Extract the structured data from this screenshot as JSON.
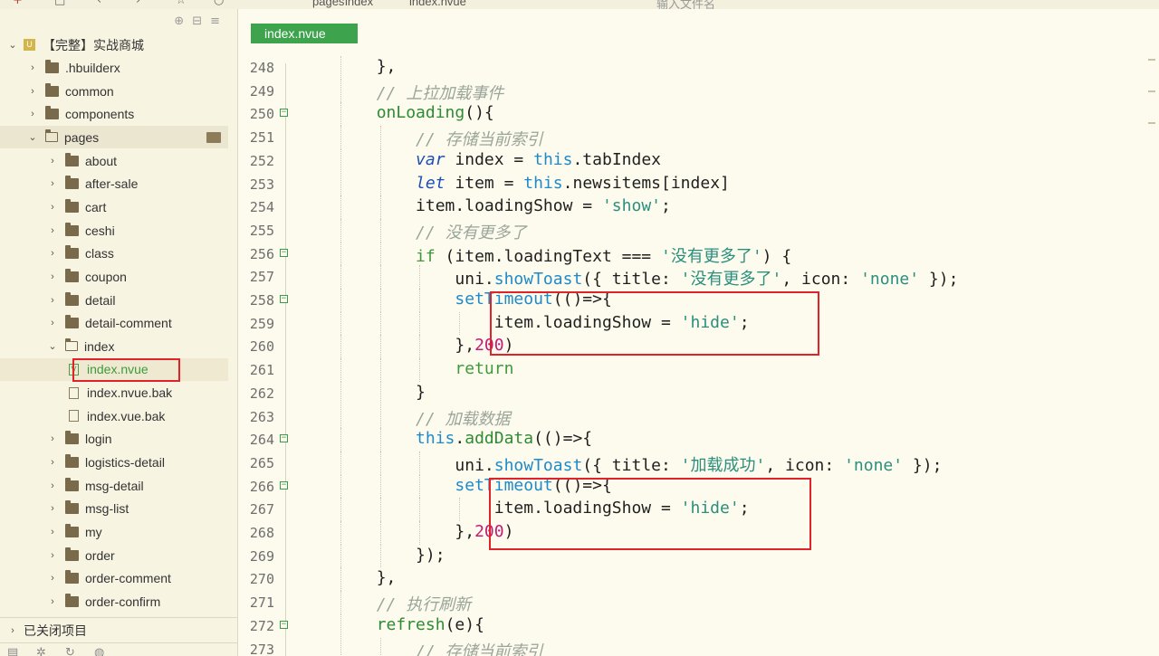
{
  "topbar": {
    "crumb_pages": "pages",
    "crumb_index": "index",
    "crumb_file": "index.nvue",
    "search_placeholder": "输入文件名"
  },
  "sidebar": {
    "project": "【完整】实战商城",
    "items": [
      {
        "label": ".hbuilderx",
        "type": "folder",
        "depth": 1
      },
      {
        "label": "common",
        "type": "folder",
        "depth": 1
      },
      {
        "label": "components",
        "type": "folder",
        "depth": 1
      },
      {
        "label": "pages",
        "type": "folder-open",
        "depth": 1
      },
      {
        "label": "about",
        "type": "folder",
        "depth": 2
      },
      {
        "label": "after-sale",
        "type": "folder",
        "depth": 2
      },
      {
        "label": "cart",
        "type": "folder",
        "depth": 2
      },
      {
        "label": "ceshi",
        "type": "folder",
        "depth": 2
      },
      {
        "label": "class",
        "type": "folder",
        "depth": 2
      },
      {
        "label": "coupon",
        "type": "folder",
        "depth": 2
      },
      {
        "label": "detail",
        "type": "folder",
        "depth": 2
      },
      {
        "label": "detail-comment",
        "type": "folder",
        "depth": 2
      },
      {
        "label": "index",
        "type": "folder-open",
        "depth": 2
      },
      {
        "label": "index.nvue",
        "type": "vue-file",
        "depth": 3
      },
      {
        "label": "index.nvue.bak",
        "type": "file",
        "depth": 3
      },
      {
        "label": "index.vue.bak",
        "type": "file",
        "depth": 3
      },
      {
        "label": "login",
        "type": "folder",
        "depth": 2
      },
      {
        "label": "logistics-detail",
        "type": "folder",
        "depth": 2
      },
      {
        "label": "msg-detail",
        "type": "folder",
        "depth": 2
      },
      {
        "label": "msg-list",
        "type": "folder",
        "depth": 2
      },
      {
        "label": "my",
        "type": "folder",
        "depth": 2
      },
      {
        "label": "order",
        "type": "folder",
        "depth": 2
      },
      {
        "label": "order-comment",
        "type": "folder",
        "depth": 2
      },
      {
        "label": "order-confirm",
        "type": "folder",
        "depth": 2
      }
    ],
    "closed_projects": "已关闭项目"
  },
  "editor": {
    "tab_label": "index.nvue",
    "lines": [
      {
        "n": "248",
        "fold": false,
        "tokens": [
          [
            "t-punc",
            "        },"
          ]
        ]
      },
      {
        "n": "249",
        "fold": false,
        "tokens": [
          [
            "t-cm",
            "        // 上拉加载事件"
          ]
        ]
      },
      {
        "n": "250",
        "fold": true,
        "tokens": [
          [
            "t-fn",
            "        onLoading"
          ],
          [
            "t-punc",
            "(){"
          ]
        ]
      },
      {
        "n": "251",
        "fold": false,
        "tokens": [
          [
            "t-cm",
            "            // 存储当前索引"
          ]
        ]
      },
      {
        "n": "252",
        "fold": false,
        "tokens": [
          [
            "t-kw",
            "            var"
          ],
          [
            "t-id",
            " index "
          ],
          [
            "t-punc",
            "= "
          ],
          [
            "t-this",
            "this"
          ],
          [
            "t-punc",
            ".tabIndex"
          ]
        ]
      },
      {
        "n": "253",
        "fold": false,
        "tokens": [
          [
            "t-kw",
            "            let"
          ],
          [
            "t-id",
            " item "
          ],
          [
            "t-punc",
            "= "
          ],
          [
            "t-this",
            "this"
          ],
          [
            "t-punc",
            ".newsitems[index]"
          ]
        ]
      },
      {
        "n": "254",
        "fold": false,
        "tokens": [
          [
            "t-id",
            "            item.loadingShow "
          ],
          [
            "t-punc",
            "= "
          ],
          [
            "t-str",
            "'show'"
          ],
          [
            "t-punc",
            ";"
          ]
        ]
      },
      {
        "n": "255",
        "fold": false,
        "tokens": [
          [
            "t-cm",
            "            // 没有更多了"
          ]
        ]
      },
      {
        "n": "256",
        "fold": true,
        "tokens": [
          [
            "t-ctrl",
            "            if"
          ],
          [
            "t-punc",
            " (item.loadingText "
          ],
          [
            "t-punc",
            "=== "
          ],
          [
            "t-str",
            "'没有更多了'"
          ],
          [
            "t-punc",
            ") {"
          ]
        ]
      },
      {
        "n": "257",
        "fold": false,
        "tokens": [
          [
            "t-id",
            "                uni."
          ],
          [
            "t-call",
            "showToast"
          ],
          [
            "t-punc",
            "({ title: "
          ],
          [
            "t-str",
            "'没有更多了'"
          ],
          [
            "t-punc",
            ", icon: "
          ],
          [
            "t-str",
            "'none'"
          ],
          [
            "t-punc",
            " });"
          ]
        ]
      },
      {
        "n": "258",
        "fold": true,
        "tokens": [
          [
            "t-call",
            "                setTimeout"
          ],
          [
            "t-punc",
            "(()=>{"
          ]
        ]
      },
      {
        "n": "259",
        "fold": false,
        "tokens": [
          [
            "t-id",
            "                    item.loadingShow "
          ],
          [
            "t-punc",
            "= "
          ],
          [
            "t-str",
            "'hide'"
          ],
          [
            "t-punc",
            ";"
          ]
        ]
      },
      {
        "n": "260",
        "fold": false,
        "tokens": [
          [
            "t-punc",
            "                },"
          ],
          [
            "t-num",
            "200"
          ],
          [
            "t-punc",
            ")"
          ]
        ]
      },
      {
        "n": "261",
        "fold": false,
        "tokens": [
          [
            "t-ctrl",
            "                return"
          ]
        ]
      },
      {
        "n": "262",
        "fold": false,
        "tokens": [
          [
            "t-punc",
            "            }"
          ]
        ]
      },
      {
        "n": "263",
        "fold": false,
        "tokens": [
          [
            "t-cm",
            "            // 加载数据"
          ]
        ]
      },
      {
        "n": "264",
        "fold": true,
        "tokens": [
          [
            "t-this",
            "            this"
          ],
          [
            "t-punc",
            "."
          ],
          [
            "t-fn",
            "addData"
          ],
          [
            "t-punc",
            "(()=>{"
          ]
        ]
      },
      {
        "n": "265",
        "fold": false,
        "tokens": [
          [
            "t-id",
            "                uni."
          ],
          [
            "t-call",
            "showToast"
          ],
          [
            "t-punc",
            "({ title: "
          ],
          [
            "t-str",
            "'加载成功'"
          ],
          [
            "t-punc",
            ", icon: "
          ],
          [
            "t-str",
            "'none'"
          ],
          [
            "t-punc",
            " });"
          ]
        ]
      },
      {
        "n": "266",
        "fold": true,
        "tokens": [
          [
            "t-call",
            "                setTimeout"
          ],
          [
            "t-punc",
            "(()=>{"
          ]
        ]
      },
      {
        "n": "267",
        "fold": false,
        "tokens": [
          [
            "t-id",
            "                    item.loadingShow "
          ],
          [
            "t-punc",
            "= "
          ],
          [
            "t-str",
            "'hide'"
          ],
          [
            "t-punc",
            ";"
          ]
        ]
      },
      {
        "n": "268",
        "fold": false,
        "tokens": [
          [
            "t-punc",
            "                },"
          ],
          [
            "t-num",
            "200"
          ],
          [
            "t-punc",
            ")"
          ]
        ]
      },
      {
        "n": "269",
        "fold": false,
        "tokens": [
          [
            "t-punc",
            "            });"
          ]
        ]
      },
      {
        "n": "270",
        "fold": false,
        "tokens": [
          [
            "t-punc",
            "        },"
          ]
        ]
      },
      {
        "n": "271",
        "fold": false,
        "tokens": [
          [
            "t-cm",
            "        // 执行刷新"
          ]
        ]
      },
      {
        "n": "272",
        "fold": true,
        "tokens": [
          [
            "t-fn",
            "        refresh"
          ],
          [
            "t-punc",
            "(e){"
          ]
        ]
      },
      {
        "n": "273",
        "fold": false,
        "tokens": [
          [
            "t-cm",
            "            // 存储当前索引"
          ]
        ]
      }
    ]
  }
}
